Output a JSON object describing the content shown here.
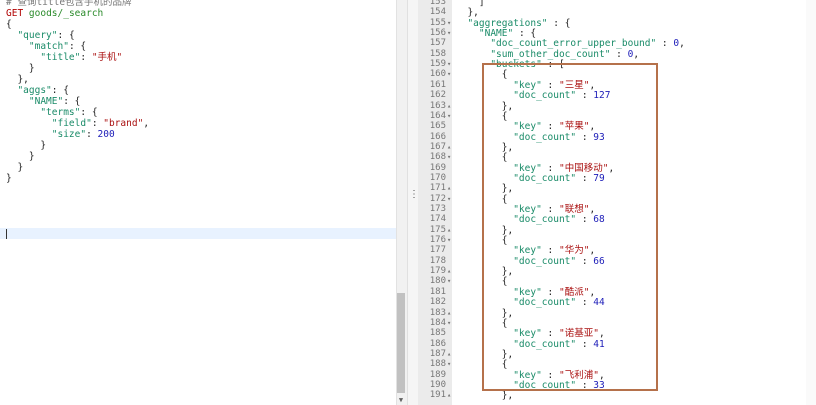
{
  "left": {
    "comment": "# 查询title包含手机的品牌",
    "method": "GET",
    "url": "goods/_search",
    "lines": [
      {
        "indent": 0,
        "t": "{"
      },
      {
        "indent": 2,
        "key": "\"query\"",
        "tail": ": {"
      },
      {
        "indent": 4,
        "key": "\"match\"",
        "tail": ": {"
      },
      {
        "indent": 6,
        "key": "\"title\"",
        "tail": ": ",
        "str": "\"手机\""
      },
      {
        "indent": 4,
        "t": "}"
      },
      {
        "indent": 2,
        "t": "},"
      },
      {
        "indent": 2,
        "key": "\"aggs\"",
        "tail": ": {"
      },
      {
        "indent": 4,
        "key": "\"NAME\"",
        "tail": ": {"
      },
      {
        "indent": 6,
        "key": "\"terms\"",
        "tail": ": {"
      },
      {
        "indent": 8,
        "key": "\"field\"",
        "tail": ": ",
        "str": "\"brand\"",
        "end": ","
      },
      {
        "indent": 8,
        "key": "\"size\"",
        "tail": ": ",
        "num": "200"
      },
      {
        "indent": 6,
        "t": "}"
      },
      {
        "indent": 4,
        "t": "}"
      },
      {
        "indent": 2,
        "t": "}"
      },
      {
        "indent": 0,
        "t": "}"
      }
    ]
  },
  "right": {
    "lines": [
      {
        "no": "153",
        "fold": "",
        "indent": 4,
        "t": "]"
      },
      {
        "no": "154",
        "fold": "",
        "indent": 2,
        "t": "},"
      },
      {
        "no": "155",
        "fold": "▾",
        "indent": 2,
        "key": "\"aggregations\"",
        "tail": " : {"
      },
      {
        "no": "156",
        "fold": "▾",
        "indent": 4,
        "key": "\"NAME\"",
        "tail": " : {"
      },
      {
        "no": "157",
        "fold": "",
        "indent": 6,
        "key": "\"doc_count_error_upper_bound\"",
        "tail": " : ",
        "num": "0",
        "end": ","
      },
      {
        "no": "158",
        "fold": "",
        "indent": 6,
        "key": "\"sum_other_doc_count\"",
        "tail": " : ",
        "num": "0",
        "end": ","
      },
      {
        "no": "159",
        "fold": "▾",
        "indent": 6,
        "key": "\"buckets\"",
        "tail": " : ["
      },
      {
        "no": "160",
        "fold": "▾",
        "indent": 8,
        "t": "{"
      },
      {
        "no": "161",
        "fold": "",
        "indent": 10,
        "key": "\"key\"",
        "tail": " : ",
        "str": "\"三星\"",
        "end": ","
      },
      {
        "no": "162",
        "fold": "",
        "indent": 10,
        "key": "\"doc_count\"",
        "tail": " : ",
        "num": "127"
      },
      {
        "no": "163",
        "fold": "▴",
        "indent": 8,
        "t": "},"
      },
      {
        "no": "164",
        "fold": "▾",
        "indent": 8,
        "t": "{"
      },
      {
        "no": "165",
        "fold": "",
        "indent": 10,
        "key": "\"key\"",
        "tail": " : ",
        "str": "\"苹果\"",
        "end": ","
      },
      {
        "no": "166",
        "fold": "",
        "indent": 10,
        "key": "\"doc_count\"",
        "tail": " : ",
        "num": "93"
      },
      {
        "no": "167",
        "fold": "▴",
        "indent": 8,
        "t": "},"
      },
      {
        "no": "168",
        "fold": "▾",
        "indent": 8,
        "t": "{"
      },
      {
        "no": "169",
        "fold": "",
        "indent": 10,
        "key": "\"key\"",
        "tail": " : ",
        "str": "\"中国移动\"",
        "end": ","
      },
      {
        "no": "170",
        "fold": "",
        "indent": 10,
        "key": "\"doc_count\"",
        "tail": " : ",
        "num": "79"
      },
      {
        "no": "171",
        "fold": "▴",
        "indent": 8,
        "t": "},"
      },
      {
        "no": "172",
        "fold": "▾",
        "indent": 8,
        "t": "{"
      },
      {
        "no": "173",
        "fold": "",
        "indent": 10,
        "key": "\"key\"",
        "tail": " : ",
        "str": "\"联想\"",
        "end": ","
      },
      {
        "no": "174",
        "fold": "",
        "indent": 10,
        "key": "\"doc_count\"",
        "tail": " : ",
        "num": "68"
      },
      {
        "no": "175",
        "fold": "▴",
        "indent": 8,
        "t": "},"
      },
      {
        "no": "176",
        "fold": "▾",
        "indent": 8,
        "t": "{"
      },
      {
        "no": "177",
        "fold": "",
        "indent": 10,
        "key": "\"key\"",
        "tail": " : ",
        "str": "\"华为\"",
        "end": ","
      },
      {
        "no": "178",
        "fold": "",
        "indent": 10,
        "key": "\"doc_count\"",
        "tail": " : ",
        "num": "66"
      },
      {
        "no": "179",
        "fold": "▴",
        "indent": 8,
        "t": "},"
      },
      {
        "no": "180",
        "fold": "▾",
        "indent": 8,
        "t": "{"
      },
      {
        "no": "181",
        "fold": "",
        "indent": 10,
        "key": "\"key\"",
        "tail": " : ",
        "str": "\"酷派\"",
        "end": ","
      },
      {
        "no": "182",
        "fold": "",
        "indent": 10,
        "key": "\"doc_count\"",
        "tail": " : ",
        "num": "44"
      },
      {
        "no": "183",
        "fold": "▴",
        "indent": 8,
        "t": "},"
      },
      {
        "no": "184",
        "fold": "▾",
        "indent": 8,
        "t": "{"
      },
      {
        "no": "185",
        "fold": "",
        "indent": 10,
        "key": "\"key\"",
        "tail": " : ",
        "str": "\"诺基亚\"",
        "end": ","
      },
      {
        "no": "186",
        "fold": "",
        "indent": 10,
        "key": "\"doc_count\"",
        "tail": " : ",
        "num": "41"
      },
      {
        "no": "187",
        "fold": "▴",
        "indent": 8,
        "t": "},"
      },
      {
        "no": "188",
        "fold": "▾",
        "indent": 8,
        "t": "{"
      },
      {
        "no": "189",
        "fold": "",
        "indent": 10,
        "key": "\"key\"",
        "tail": " : ",
        "str": "\"飞利浦\"",
        "end": ","
      },
      {
        "no": "190",
        "fold": "",
        "indent": 10,
        "key": "\"doc_count\"",
        "tail": " : ",
        "num": "33"
      },
      {
        "no": "191",
        "fold": "▴",
        "indent": 8,
        "t": "},"
      }
    ]
  },
  "ui": {
    "divider_icon": "⋮",
    "scroll_down_icon": "▼"
  }
}
